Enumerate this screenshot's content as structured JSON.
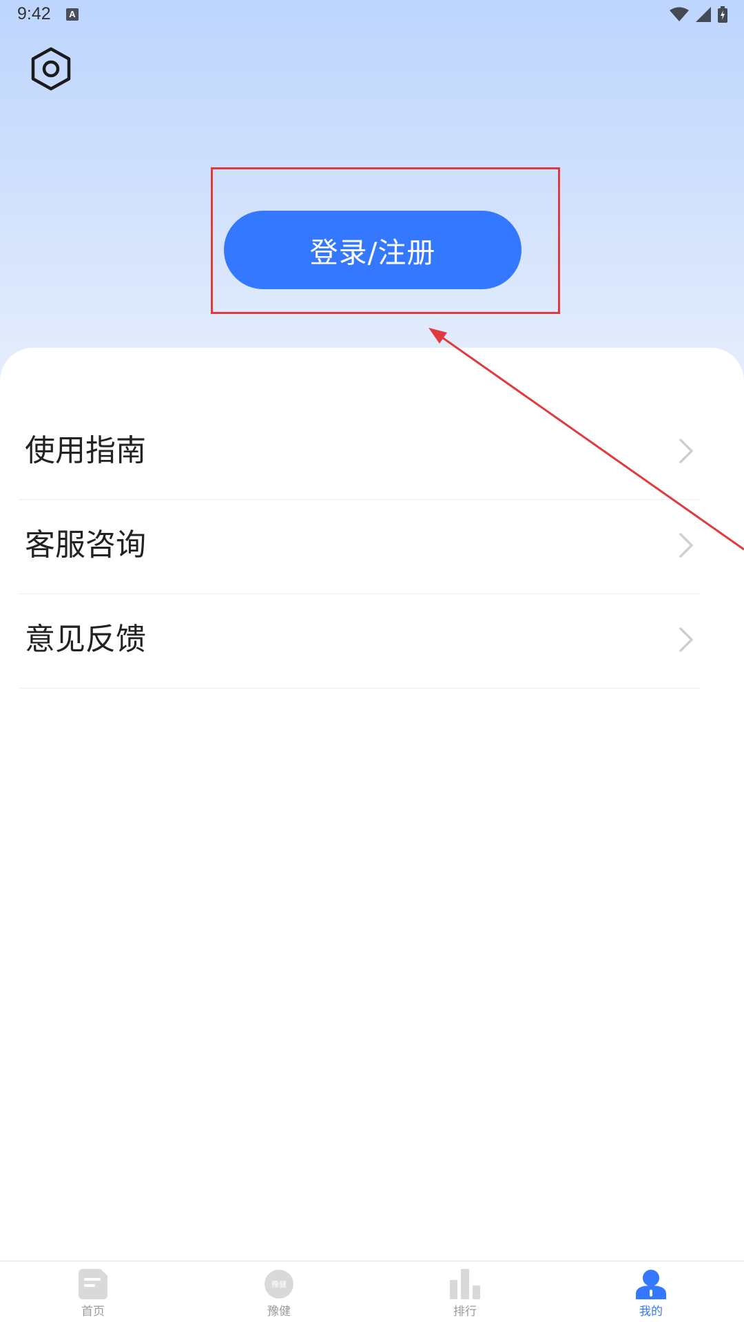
{
  "status_bar": {
    "time": "9:42",
    "notification_icon": "A"
  },
  "header": {
    "settings_icon": "hexagon-settings-icon"
  },
  "login": {
    "button_label": "登录/注册"
  },
  "menu": {
    "items": [
      {
        "label": "使用指南"
      },
      {
        "label": "客服咨询"
      },
      {
        "label": "意见反馈"
      }
    ]
  },
  "tabbar": {
    "tabs": [
      {
        "label": "首页",
        "icon": "document-icon"
      },
      {
        "label": "豫健",
        "icon": "yujian-logo-icon",
        "icon_text": "豫健"
      },
      {
        "label": "排行",
        "icon": "bar-chart-icon"
      },
      {
        "label": "我的",
        "icon": "user-icon",
        "active": true
      }
    ]
  },
  "colors": {
    "accent": "#3478ff",
    "annotation": "#e0393e",
    "inactive": "#d9d9d9"
  }
}
